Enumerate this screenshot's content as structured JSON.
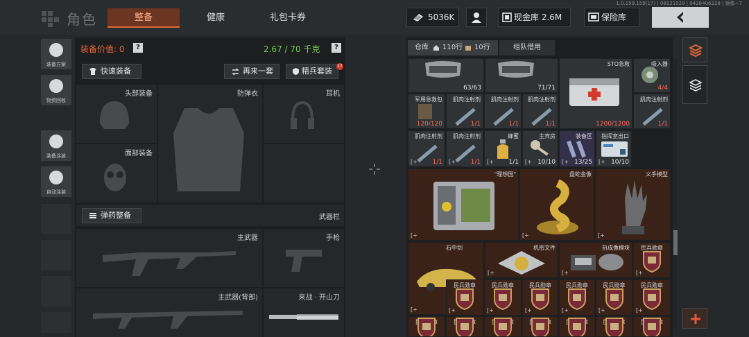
{
  "header": {
    "title": "角色",
    "tabs": [
      {
        "label": "整备",
        "active": true
      },
      {
        "label": "健康",
        "active": false
      },
      {
        "label": "礼包卡券",
        "active": false
      }
    ],
    "version": "1.0.159.159(17) | 08121029 | 9428406228 | 镜像~7",
    "cash_value": "5036K",
    "vault_label": "现金库 2.6M",
    "safe_label": "保险库"
  },
  "sidebar": {
    "items": [
      {
        "label": "装备方案",
        "icon": "gear-loadout-icon"
      },
      {
        "label": "物资回收",
        "icon": "recycle-icon"
      },
      {
        "label": "装备涂装",
        "icon": "paint-icon"
      },
      {
        "label": "自动涂装",
        "icon": "auto-paint-icon"
      }
    ]
  },
  "equip": {
    "value_label": "装备价值: 0",
    "weight_label": "2.67 / 70 千克",
    "help": "?",
    "quick_equip": "快速装备",
    "again": "再来一套",
    "elite": "精兵套装",
    "elite_badge": "17",
    "slots": {
      "helmet": "头部装备",
      "armor": "防弹衣",
      "earphone": "耳机",
      "face": "面部装备",
      "ammo_btn": "弹药整备",
      "weapon_bar": "武器栏",
      "primary": "主武器",
      "pistol": "手枪",
      "primary_back": "主武器(背部)",
      "melee": "来战 · 开山刀"
    }
  },
  "inventory": {
    "tabs": {
      "warehouse": "仓库",
      "rows_1": "110行",
      "rows_2": "10行",
      "borrow": "组队借用"
    },
    "row1": [
      {
        "name": "",
        "count": "63/63"
      },
      {
        "name": "",
        "count": "71/71"
      },
      {
        "name": "STO急救",
        "count": "1200/1200",
        "red": true
      },
      {
        "name": "吸入器",
        "count": "4/4",
        "red": true
      }
    ],
    "row2": [
      {
        "name": "军用急救包",
        "count": "120/120",
        "red": true
      },
      {
        "name": "肌肉注射剂",
        "count": "1/1",
        "red": true
      },
      {
        "name": "肌肉注射剂",
        "count": "1/1",
        "red": true
      },
      {
        "name": "肌肉注射剂",
        "count": "1/1",
        "red": true
      },
      {
        "name": "肌肉注射剂",
        "count": "1/1",
        "red": true
      }
    ],
    "row3": [
      {
        "name": "肌肉注射剂",
        "count": "1/1",
        "red": true
      },
      {
        "name": "肌肉注射剂",
        "count": "1/1",
        "red": true
      },
      {
        "name": "蜂蜜",
        "count": "1/1",
        "red": false
      },
      {
        "name": "主宾房",
        "count": "10/10",
        "red": false
      },
      {
        "name": "装备区",
        "count": "13/25",
        "red": false
      },
      {
        "name": "指挥室出口",
        "count": "10/10",
        "red": false
      }
    ],
    "big": [
      {
        "name": "\"理想国\""
      },
      {
        "name": "盘蛇金像"
      },
      {
        "name": "义手模型"
      }
    ],
    "row5": [
      {
        "name": "石中剑"
      },
      {
        "name": "机密文件"
      },
      {
        "name": "热成像模块"
      }
    ],
    "badge_name": "民兵勋章",
    "link_icon": "[+"
  },
  "colors": {
    "accent": "#e06a3a",
    "weight_green": "#78d04a",
    "count_red": "#ff6a5a"
  }
}
